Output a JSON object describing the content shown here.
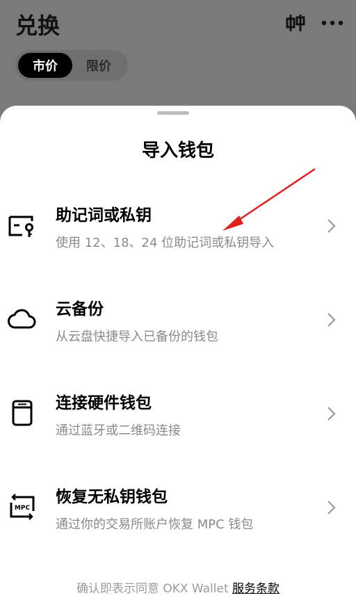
{
  "background": {
    "title": "兑换",
    "tabs": [
      {
        "label": "市价",
        "active": true
      },
      {
        "label": "限价",
        "active": false
      }
    ]
  },
  "sheet": {
    "title": "导入钱包",
    "options": [
      {
        "title": "助记词或私钥",
        "subtitle": "使用 12、18、24 位助记词或私钥导入",
        "icon": "key-wallet-icon"
      },
      {
        "title": "云备份",
        "subtitle": "从云盘快捷导入已备份的钱包",
        "icon": "cloud-icon"
      },
      {
        "title": "连接硬件钱包",
        "subtitle": "通过蓝牙或二维码连接",
        "icon": "hardware-wallet-icon"
      },
      {
        "title": "恢复无私钥钱包",
        "subtitle": "通过你的交易所账户恢复 MPC 钱包",
        "icon": "mpc-icon"
      }
    ],
    "footer": {
      "text": "确认即表示同意 OKX Wallet ",
      "link": "服务条款"
    }
  },
  "colors": {
    "overlay": "#7a7a7a",
    "annotation_arrow": "#e0201c"
  }
}
